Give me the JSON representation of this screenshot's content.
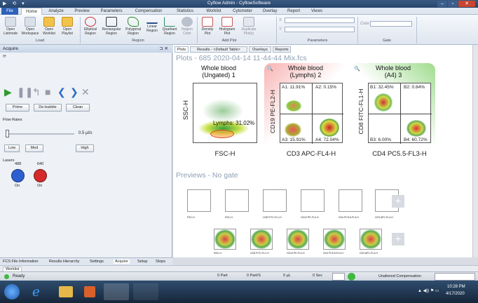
{
  "window": {
    "title": "Cyflow Admin - CyflowSoftware",
    "quick_access": "▶ ⟲ ▾",
    "min": "–",
    "max": "▫",
    "close": "✕"
  },
  "tabs": [
    "File",
    "Home",
    "Analyze",
    "Preview",
    "Parameters",
    "Compensation",
    "Statistics",
    "Worklist",
    "Cytometer",
    "Overlay",
    "Report",
    "Views"
  ],
  "ribbon": {
    "load": {
      "buttons": [
        "Open\nListmode",
        "Open\nWorkspace",
        "Open\nWorklist",
        "Open\nPlaylist"
      ],
      "label": "Load"
    },
    "region": {
      "buttons": [
        "Elliptical\nRegion",
        "Rectangular\nRegion",
        "Polygonal\nRegion",
        "Linear\nRegion",
        "Quadrant\nRegion",
        "Region\nColor"
      ],
      "label": "Region"
    },
    "addplot": {
      "buttons": [
        "Density\nPlot",
        "Histogram\nPlot",
        "Duplicate\nPlot(s)"
      ],
      "label": "Add Plot"
    },
    "parameters": {
      "x": "X",
      "y": "Y",
      "label": "Parameters"
    },
    "gate": {
      "gate_label": "Gate",
      "label": "Gate"
    }
  },
  "acquire": {
    "title": "Acquire",
    "prime": "Prime",
    "debubble": "De-bubble",
    "clean": "Clean",
    "flow_rates": "Flow Rates",
    "rate_value": "0.5 µl/s",
    "low": "Low",
    "med": "Med",
    "high": "High",
    "lasers": "Lasers",
    "laser1": {
      "wavelength": "488",
      "state": "On",
      "color": "#2d5fd0"
    },
    "laser2": {
      "wavelength": "640",
      "state": "On",
      "color": "#d42a2a"
    }
  },
  "bottom_tabs": [
    "FCS File Information",
    "Results Hierarchy",
    "Settings",
    "Acquire",
    "Setup",
    "Stops"
  ],
  "worklist_tab": "Worklist",
  "main_tabs": [
    "Plots",
    "Results - <Default Table>",
    "Overlays",
    "Reports"
  ],
  "plots_header": "Plots - 685 2020-04-14 11-44-44 Mix.fcs",
  "plot1": {
    "title": "Whole blood\n(Ungated) 1",
    "xlabel": "FSC-H",
    "ylabel": "SSC-H",
    "gate": "Lymphs: 31.02%"
  },
  "plot2": {
    "title": "Whole blood\n(Lymphs) 2",
    "xlabel": "CD3 APC-FL4-H",
    "ylabel": "CD19 PE-FL2-H",
    "q1": "A1: 11.91%",
    "q2": "A2: 0.15%",
    "q3": "A3: 15.91%",
    "q4": "A4: 72.04%"
  },
  "plot3": {
    "title": "Whole blood\n(A4) 3",
    "xlabel": "CD4 PC5.5-FL3-H",
    "ylabel": "CD8 FITC-FL1-H",
    "q1": "B1: 32.45%",
    "q2": "B2: 0.84%",
    "q3": "B3: 6.00%",
    "q4": "B4: 60.72%"
  },
  "previews_header": "Previews - No gate",
  "preview_hist_labels": [
    "FSC-H",
    "SSC-H",
    "CD8 FITC-FL1-H",
    "CD19 PE-FL2-H",
    "CD4 PC5.5-FL3-H",
    "CD3 APC-FL4-H"
  ],
  "preview_dot_labels": [
    "SSC-H",
    "CD8 FITC-FL1-H",
    "CD19 PE-FL2-H",
    "CD4 PC5.5-FL3-H",
    "CD3 APC-FL4-H"
  ],
  "status": {
    "ready": "Ready",
    "part": "0 Part",
    "parts": "0 Part/S",
    "ul": "0 µL",
    "sec": "0 Sec",
    "comp": "Unaltered Compensation"
  },
  "taskbar": {
    "time": "10:28 PM",
    "date": "4/17/2020"
  }
}
